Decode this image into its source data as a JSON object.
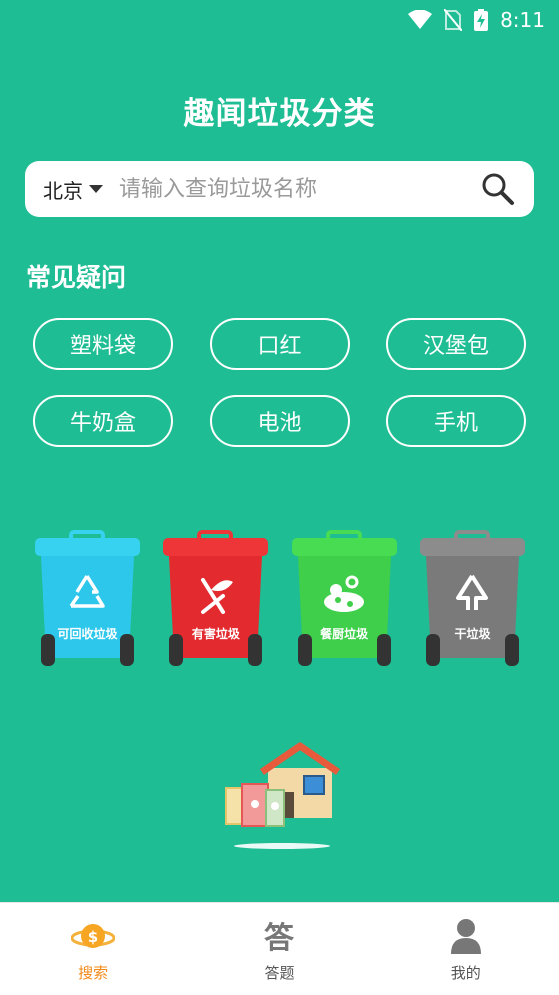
{
  "status_bar": {
    "time": "8:11"
  },
  "app": {
    "title": "趣闻垃圾分类"
  },
  "search": {
    "city": "北京",
    "placeholder": "请输入查询垃圾名称"
  },
  "faq": {
    "title": "常见疑问",
    "items": [
      "塑料袋",
      "口红",
      "汉堡包",
      "牛奶盒",
      "电池",
      "手机"
    ]
  },
  "bins": [
    {
      "label": "可回收垃圾",
      "color": "#2ec7ec",
      "lid": "#36d2f0"
    },
    {
      "label": "有害垃圾",
      "color": "#e22a2f",
      "lid": "#ee3538"
    },
    {
      "label": "餐厨垃圾",
      "color": "#3fcf4a",
      "lid": "#48dc52"
    },
    {
      "label": "干垃圾",
      "color": "#7a7a7a",
      "lid": "#8c8c8c"
    }
  ],
  "tabs": [
    {
      "label": "搜索",
      "icon": "coin-planet-icon",
      "active": true
    },
    {
      "label": "答题",
      "icon": "answer-icon",
      "active": false
    },
    {
      "label": "我的",
      "icon": "user-icon",
      "active": false
    }
  ],
  "colors": {
    "background": "#1fbd94",
    "active_tab": "#f28a1a"
  }
}
